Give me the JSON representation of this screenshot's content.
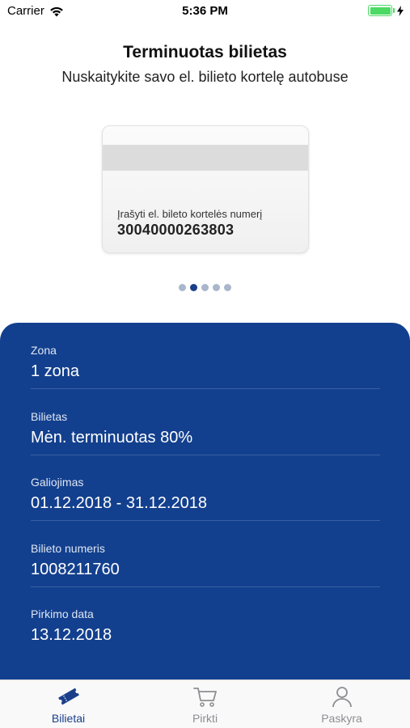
{
  "status_bar": {
    "carrier": "Carrier",
    "time": "5:36 PM"
  },
  "header": {
    "title": "Terminuotas bilietas",
    "subtitle": "Nuskaitykite savo el. bilieto kortelę autobuse"
  },
  "card": {
    "label": "Įrašyti el. bileto kortelės numerį",
    "number": "30040000263803"
  },
  "pager": {
    "total": 5,
    "active_index": 1
  },
  "details": [
    {
      "label": "Zona",
      "value": "1 zona"
    },
    {
      "label": "Bilietas",
      "value": "Mėn. terminuotas 80%"
    },
    {
      "label": "Galiojimas",
      "value": "01.12.2018 - 31.12.2018"
    },
    {
      "label": "Bilieto numeris",
      "value": "1008211760"
    },
    {
      "label": "Pirkimo data",
      "value": "13.12.2018"
    }
  ],
  "tabbar": {
    "items": [
      {
        "label": "Bilietai",
        "icon": "ticket-icon",
        "active": true
      },
      {
        "label": "Pirkti",
        "icon": "cart-icon",
        "active": false
      },
      {
        "label": "Paskyra",
        "icon": "person-icon",
        "active": false
      }
    ]
  },
  "colors": {
    "panel": "#13408e",
    "accent": "#1a3f8a",
    "battery": "#4cd964",
    "tab_inactive": "#8e8e93"
  }
}
